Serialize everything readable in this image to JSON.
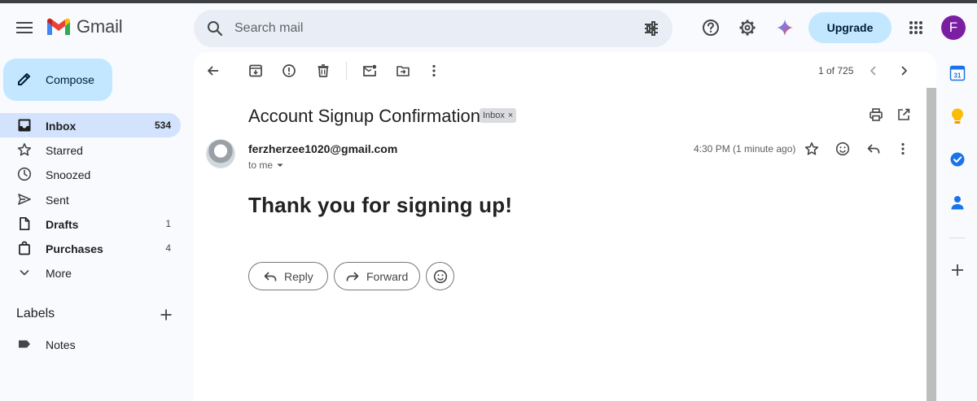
{
  "app": {
    "name": "Gmail"
  },
  "search": {
    "placeholder": "Search mail"
  },
  "header": {
    "upgrade_label": "Upgrade",
    "account_initial": "F"
  },
  "compose": {
    "label": "Compose"
  },
  "nav": {
    "items": [
      {
        "label": "Inbox",
        "count": "534",
        "active": true,
        "bold": true,
        "icon": "inbox-icon"
      },
      {
        "label": "Starred",
        "count": "",
        "icon": "star-icon"
      },
      {
        "label": "Snoozed",
        "count": "",
        "icon": "clock-icon"
      },
      {
        "label": "Sent",
        "count": "",
        "icon": "send-icon"
      },
      {
        "label": "Drafts",
        "count": "1",
        "bold": true,
        "icon": "draft-icon"
      },
      {
        "label": "Purchases",
        "count": "4",
        "bold": true,
        "icon": "shopping-bag-icon"
      },
      {
        "label": "More",
        "count": "",
        "icon": "chevron-down-icon"
      }
    ]
  },
  "labels": {
    "heading": "Labels",
    "items": [
      {
        "label": "Notes",
        "icon": "label-icon"
      }
    ]
  },
  "toolbar": {
    "pager": "1 of 725"
  },
  "message": {
    "subject": "Account Signup Confirmation",
    "chip": "Inbox",
    "sender": "ferzherzee1020@gmail.com",
    "to": "to me",
    "time": "4:30 PM (1 minute ago)",
    "body_heading": "Thank you for signing up!"
  },
  "actions": {
    "reply": "Reply",
    "forward": "Forward"
  },
  "side_panel": {
    "calendar_day": "31"
  },
  "colors": {
    "accent": "#c2e7ff",
    "active_nav": "#d3e3fd",
    "avatar_bg": "#7b1fa2"
  }
}
